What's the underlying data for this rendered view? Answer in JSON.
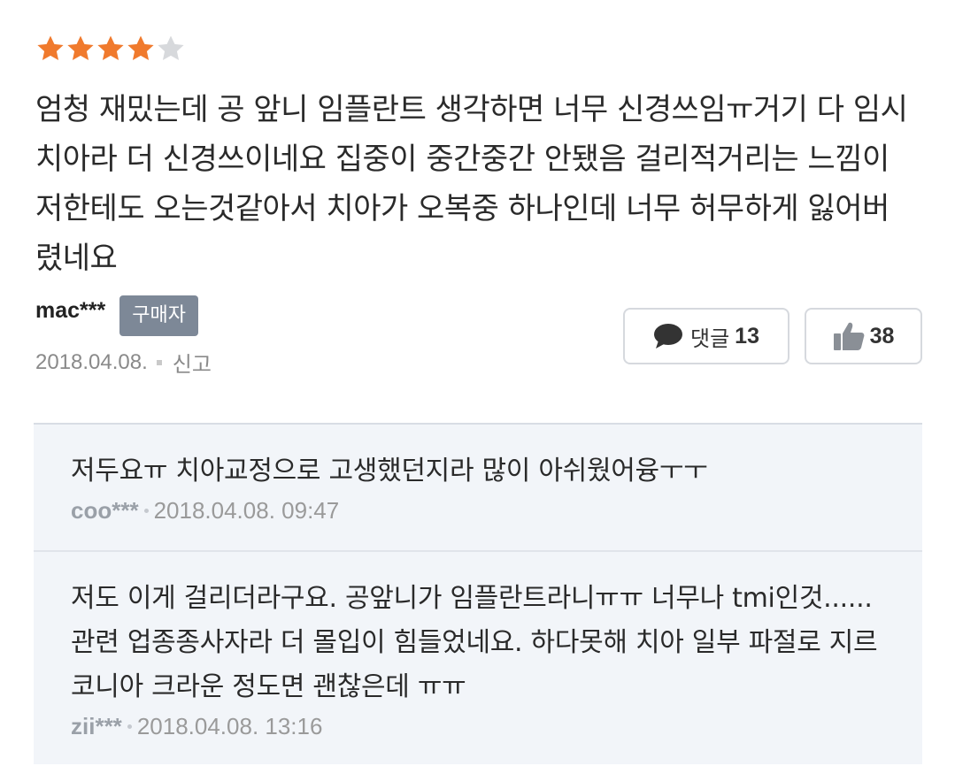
{
  "review": {
    "rating": 4,
    "max_rating": 5,
    "star_color": "#f07a2d",
    "star_empty_color": "#d7d9dc",
    "text": "엄청 재밌는데 공 앞니 임플란트 생각하면 너무 신경쓰임ㅠ거기 다 임시치아라 더 신경쓰이네요 집중이 중간중간 안됐음 걸리적거리는 느낌이 저한테도 오는것같아서 치아가 오복중 하나인데 너무 허무하게 잃어버렸네요",
    "author": "mac***",
    "badge": "구매자",
    "date": "2018.04.08.",
    "report_label": "신고",
    "comments_button": {
      "label": "댓글",
      "count": "13",
      "icon": "speech-bubble-icon"
    },
    "like_button": {
      "count": "38",
      "icon": "thumbs-up-icon"
    }
  },
  "comments": [
    {
      "text": "저두요ㅠ 치아교정으로 고생했던지라 많이 아쉬웠어융ㅜㅜ",
      "author": "coo***",
      "datetime": "2018.04.08. 09:47"
    },
    {
      "text": "저도 이게 걸리더라구요. 공앞니가 임플란트라니ㅠㅠ 너무나 tmi인것...... 관련 업종종사자라 더 몰입이 힘들었네요. 하다못해 치아 일부 파절로 지르코니아 크라운 정도면 괜찮은데 ㅠㅠ",
      "author": "zii***",
      "datetime": "2018.04.08. 13:16"
    }
  ]
}
